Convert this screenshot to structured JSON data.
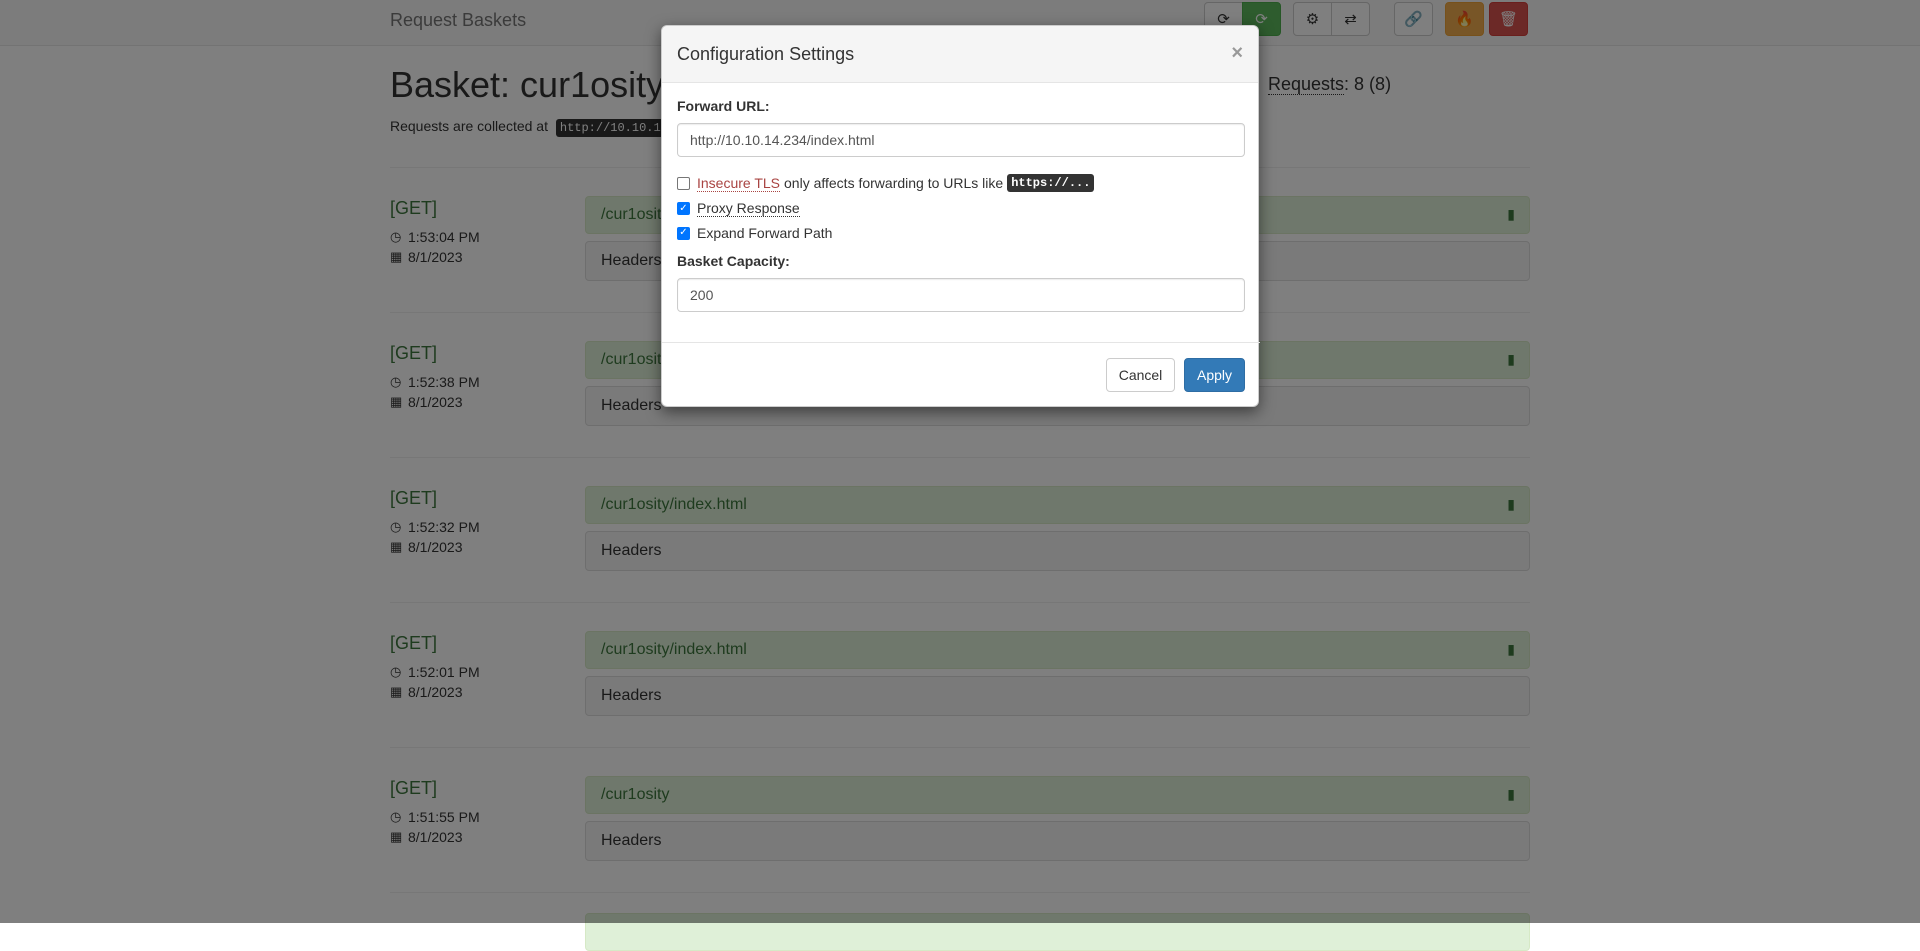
{
  "navbar": {
    "brand": "Request Baskets",
    "buttons": [
      {
        "name": "refresh-button",
        "icon": "refresh-icon",
        "glyph": "⟳"
      },
      {
        "name": "auto-refresh-button",
        "icon": "auto-refresh-icon",
        "glyph": "⟳"
      },
      {
        "name": "settings-button",
        "icon": "gear-icon",
        "glyph": "⚙"
      },
      {
        "name": "responses-button",
        "icon": "transfer-icon",
        "glyph": "⇄"
      },
      {
        "name": "share-button",
        "icon": "link-icon",
        "glyph": "🔗"
      },
      {
        "name": "clear-button",
        "icon": "fire-icon",
        "glyph": "🔥"
      },
      {
        "name": "delete-button",
        "icon": "trash-icon",
        "glyph": "🗑"
      }
    ]
  },
  "basket": {
    "title": "Basket: cur1osity",
    "collect_text": "Requests are collected at",
    "collect_url": "http://10.10.1",
    "requests_label": "Requests",
    "requests_count": ": 8 (8)"
  },
  "requests": [
    {
      "method": "[GET]",
      "time": "1:53:04 PM",
      "date": "8/1/2023",
      "path": "/cur1osit",
      "headers": "Headers"
    },
    {
      "method": "[GET]",
      "time": "1:52:38 PM",
      "date": "8/1/2023",
      "path": "/cur1osit",
      "headers": "Headers"
    },
    {
      "method": "[GET]",
      "time": "1:52:32 PM",
      "date": "8/1/2023",
      "path": "/cur1osity/index.html",
      "headers": "Headers"
    },
    {
      "method": "[GET]",
      "time": "1:52:01 PM",
      "date": "8/1/2023",
      "path": "/cur1osity/index.html",
      "headers": "Headers"
    },
    {
      "method": "[GET]",
      "time": "1:51:55 PM",
      "date": "8/1/2023",
      "path": "/cur1osity",
      "headers": "Headers"
    }
  ],
  "modal": {
    "title": "Configuration Settings",
    "close": "×",
    "forward_url_label": "Forward URL:",
    "forward_url_value": "http://10.10.14.234/index.html",
    "insecure_tls": {
      "label": "Insecure TLS",
      "note": "only affects forwarding to URLs like",
      "code": "https://...",
      "checked": false
    },
    "proxy_response": {
      "label": "Proxy Response",
      "checked": true
    },
    "expand_forward_path": {
      "label": "Expand Forward Path",
      "checked": true
    },
    "capacity_label": "Basket Capacity:",
    "capacity_value": "200",
    "cancel": "Cancel",
    "apply": "Apply"
  },
  "colors": {
    "green": "#5cb85c",
    "orange": "#f0ad4e",
    "red": "#d9534f",
    "primary": "#337ab7",
    "success_bg": "#dff0d8",
    "success_text": "#3c763d"
  }
}
